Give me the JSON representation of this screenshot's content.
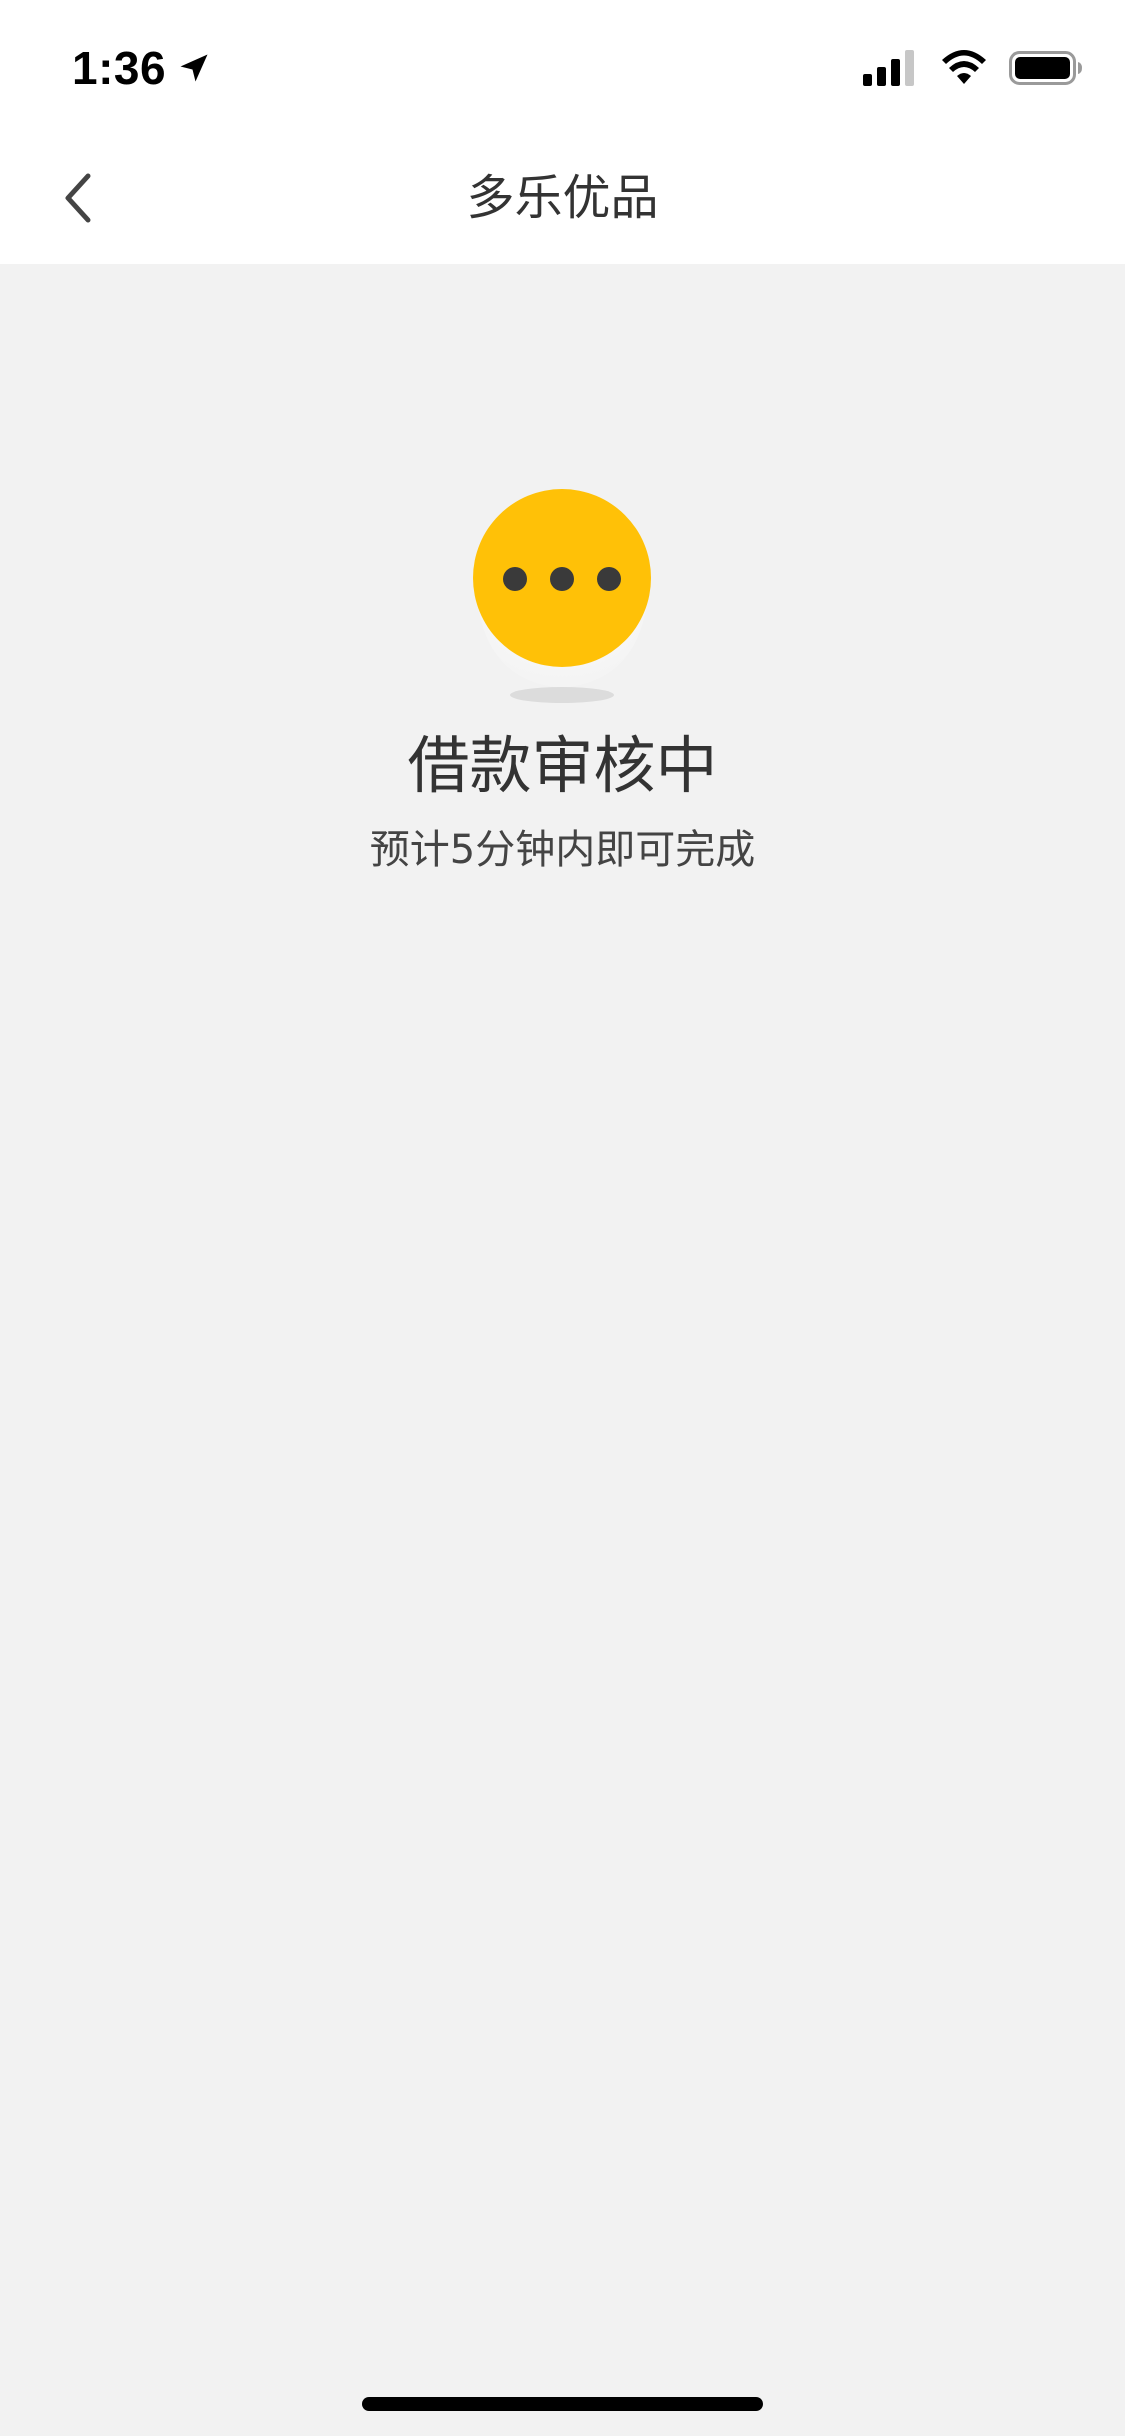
{
  "status_bar": {
    "time": "1:36",
    "icons": [
      "location-arrow-icon",
      "cellular-signal-icon",
      "wifi-icon",
      "battery-icon"
    ]
  },
  "nav": {
    "title": "多乐优品",
    "back_icon": "chevron-left-icon"
  },
  "main": {
    "status_icon": "ellipsis-circle-icon",
    "title": "借款审核中",
    "subtitle": "预计5分钟内即可完成"
  },
  "colors": {
    "accent": "#FFC107",
    "background": "#F2F2F2",
    "nav_background": "#FFFFFF",
    "text_primary": "#333333"
  }
}
